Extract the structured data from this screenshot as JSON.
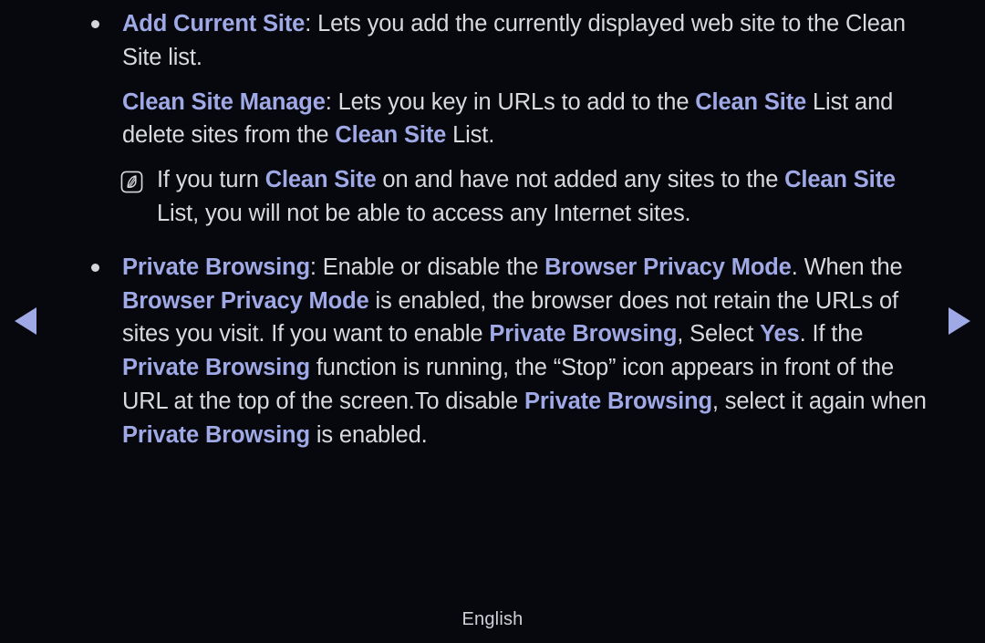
{
  "theme": {
    "background": "#07070e",
    "text_color": "#d8dade",
    "highlight_color": "#9fa9e6",
    "arrow_color": "#9fa9e6"
  },
  "nav": {
    "prev_icon": "triangle-left-icon",
    "next_icon": "triangle-right-icon"
  },
  "footer": {
    "language": "English"
  },
  "content": {
    "blocks": [
      {
        "type": "bullet",
        "marker": "bullet-dot",
        "runs": [
          {
            "text": "Add Current Site",
            "style": "highlight"
          },
          {
            "text": ": Lets you add the currently displayed web site to the Clean Site list.",
            "style": "normal"
          }
        ]
      },
      {
        "type": "plain",
        "runs": [
          {
            "text": "Clean Site Manage",
            "style": "highlight"
          },
          {
            "text": ": Lets you key in URLs to add to the ",
            "style": "normal"
          },
          {
            "text": "Clean Site",
            "style": "highlight"
          },
          {
            "text": " List and delete sites from the ",
            "style": "normal"
          },
          {
            "text": "Clean Site",
            "style": "highlight"
          },
          {
            "text": " List.",
            "style": "normal"
          }
        ]
      },
      {
        "type": "note",
        "marker": "note-quill-icon",
        "runs": [
          {
            "text": "If you turn ",
            "style": "normal"
          },
          {
            "text": "Clean Site",
            "style": "highlight"
          },
          {
            "text": " on and have not added any sites to the ",
            "style": "normal"
          },
          {
            "text": "Clean Site",
            "style": "highlight"
          },
          {
            "text": " List, you will not be able to access any Internet sites.",
            "style": "normal"
          }
        ]
      },
      {
        "type": "bullet",
        "marker": "bullet-dot",
        "runs": [
          {
            "text": "Private Browsing",
            "style": "highlight"
          },
          {
            "text": ": Enable or disable the ",
            "style": "normal"
          },
          {
            "text": "Browser Privacy Mode",
            "style": "highlight"
          },
          {
            "text": ". When the ",
            "style": "normal"
          },
          {
            "text": "Browser Privacy Mode",
            "style": "highlight"
          },
          {
            "text": " is enabled, the browser does not retain the URLs of sites you visit. If you want to enable ",
            "style": "normal"
          },
          {
            "text": "Private Browsing",
            "style": "highlight"
          },
          {
            "text": ", Select ",
            "style": "normal"
          },
          {
            "text": "Yes",
            "style": "highlight"
          },
          {
            "text": ". If the ",
            "style": "normal"
          },
          {
            "text": "Private Browsing",
            "style": "highlight"
          },
          {
            "text": " function is running, the “Stop” icon appears in front of the URL at the top of the screen.To disable ",
            "style": "normal"
          },
          {
            "text": "Private Browsing",
            "style": "highlight"
          },
          {
            "text": ", select it again when ",
            "style": "normal"
          },
          {
            "text": "Private Browsing",
            "style": "highlight"
          },
          {
            "text": " is enabled.",
            "style": "normal"
          }
        ]
      }
    ]
  }
}
